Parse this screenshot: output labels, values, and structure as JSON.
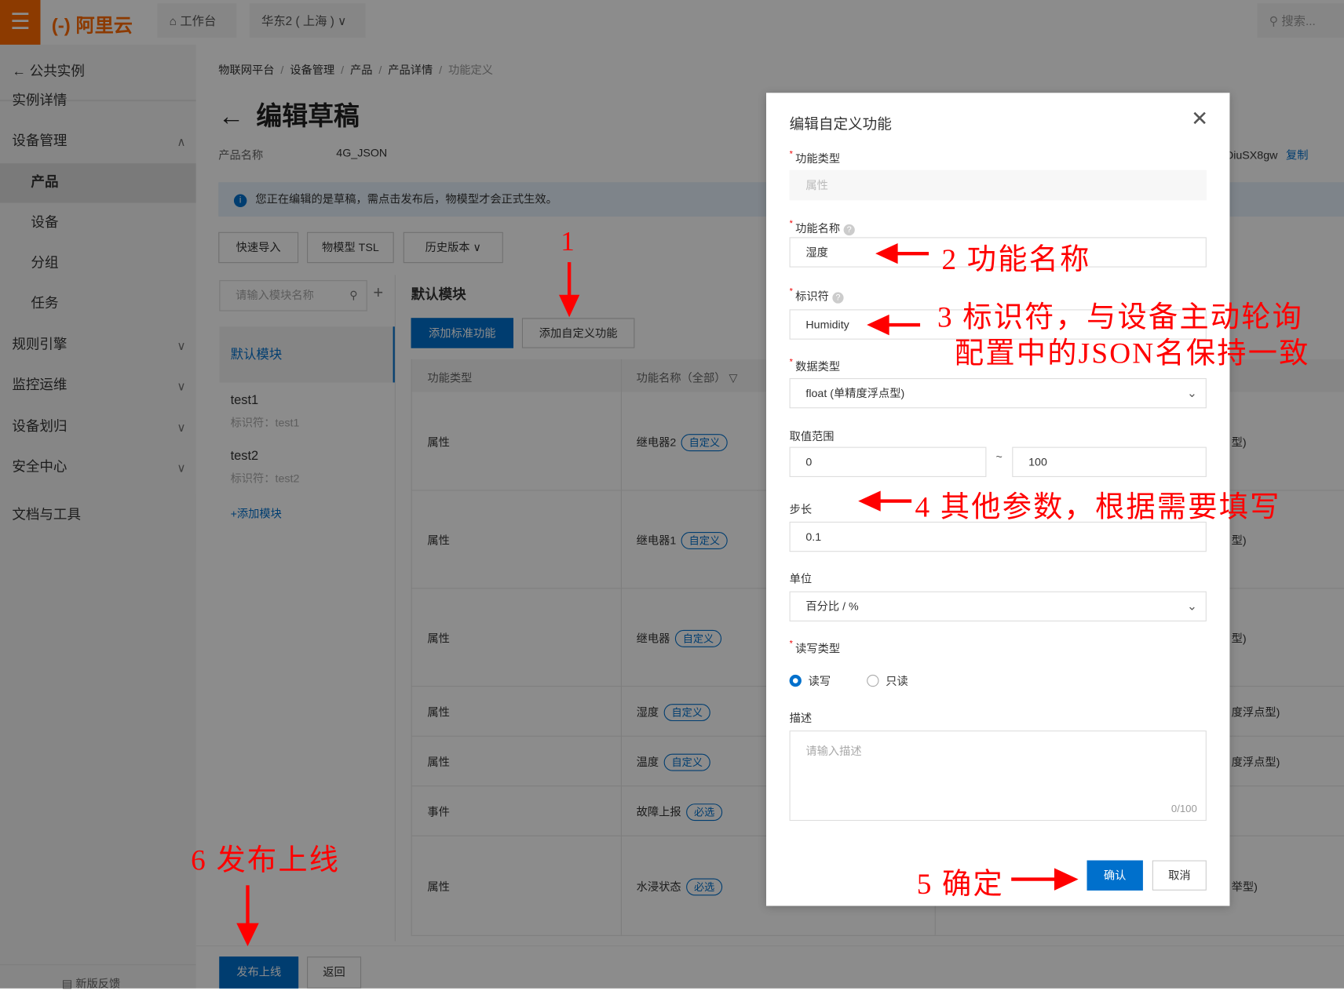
{
  "topbar": {
    "logo": "阿里云",
    "workbench": "工作台",
    "region": "华东2 ( 上海 )",
    "search_placeholder": "搜索..."
  },
  "sidebar": {
    "back": "公共实例",
    "items": [
      {
        "label": "实例详情",
        "type": "item"
      },
      {
        "label": "设备管理",
        "type": "group",
        "expanded": true
      },
      {
        "label": "产品",
        "type": "sub",
        "selected": true
      },
      {
        "label": "设备",
        "type": "sub"
      },
      {
        "label": "分组",
        "type": "sub"
      },
      {
        "label": "任务",
        "type": "sub"
      },
      {
        "label": "规则引擎",
        "type": "group"
      },
      {
        "label": "监控运维",
        "type": "group"
      },
      {
        "label": "设备划归",
        "type": "group"
      },
      {
        "label": "安全中心",
        "type": "group"
      },
      {
        "label": "文档与工具",
        "type": "item"
      }
    ],
    "feedback": "新版反馈"
  },
  "breadcrumb": [
    "物联网平台",
    "设备管理",
    "产品",
    "产品详情",
    "功能定义"
  ],
  "page": {
    "title": "编辑草稿",
    "product_label": "产品名称",
    "product_name": "4G_JSON",
    "product_key_partial": "DiuSX8gw",
    "copy": "复制",
    "notice": "您正在编辑的是草稿，需点击发布后，物模型才会正式生效。",
    "toolbar": {
      "quick_import": "快速导入",
      "tsl": "物模型 TSL",
      "history": "历史版本"
    },
    "module_search_placeholder": "请输入模块名称",
    "modules": [
      {
        "name": "默认模块",
        "selected": true
      },
      {
        "name": "test1",
        "id": "标识符：test1"
      },
      {
        "name": "test2",
        "id": "标识符：test2"
      }
    ],
    "add_module": "+添加模块",
    "module_title": "默认模块",
    "add_standard": "添加标准功能",
    "add_custom": "添加自定义功能",
    "table": {
      "headers": [
        "功能类型",
        "功能名称（全部）"
      ],
      "rows": [
        {
          "type": "属性",
          "name": "继电器2",
          "tag": "自定义",
          "extra": "型)"
        },
        {
          "type": "属性",
          "name": "继电器1",
          "tag": "自定义",
          "extra": "型)"
        },
        {
          "type": "属性",
          "name": "继电器",
          "tag": "自定义",
          "extra": "型)"
        },
        {
          "type": "属性",
          "name": "湿度",
          "tag": "自定义",
          "extra": "度浮点型)"
        },
        {
          "type": "属性",
          "name": "温度",
          "tag": "自定义",
          "extra": "度浮点型)"
        },
        {
          "type": "事件",
          "name": "故障上报",
          "tag": "必选",
          "extra": ""
        },
        {
          "type": "属性",
          "name": "水浸状态",
          "tag": "必选",
          "extra": "举型)"
        }
      ]
    },
    "publish": "发布上线",
    "back": "返回"
  },
  "modal": {
    "title": "编辑自定义功能",
    "func_type_label": "功能类型",
    "func_type_value": "属性",
    "func_name_label": "功能名称",
    "func_name_value": "湿度",
    "identifier_label": "标识符",
    "identifier_value": "Humidity",
    "data_type_label": "数据类型",
    "data_type_value": "float (单精度浮点型)",
    "range_label": "取值范围",
    "range_min": "0",
    "range_sep": "~",
    "range_max": "100",
    "step_label": "步长",
    "step_value": "0.1",
    "unit_label": "单位",
    "unit_value": "百分比 / %",
    "rw_label": "读写类型",
    "rw_options": [
      "读写",
      "只读"
    ],
    "rw_selected": "读写",
    "desc_label": "描述",
    "desc_placeholder": "请输入描述",
    "desc_counter": "0/100",
    "confirm": "确认",
    "cancel": "取消"
  },
  "annotations": {
    "a1": "1",
    "a2": "2  功能名称",
    "a3_line1": "3  标识符，与设备主动轮询",
    "a3_line2": "配置中的JSON名保持一致",
    "a4": "4  其他参数，根据需要填写",
    "a5": "5  确定",
    "a6": "6  发布上线",
    "color": "#ff0000"
  },
  "colors": {
    "brand": "#ff6a00",
    "primary": "#0070cc"
  }
}
